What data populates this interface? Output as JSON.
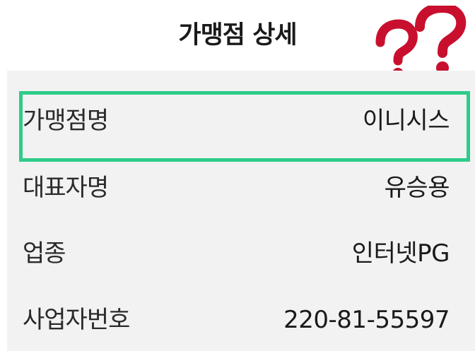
{
  "header": {
    "title": "가맹점 상세"
  },
  "annotation": {
    "icon": "question-marks-icon",
    "question_mark_color": "#c8102e",
    "highlight_color": "#2ecc8a"
  },
  "details": [
    {
      "label": "가맹점명",
      "value": "이니시스"
    },
    {
      "label": "대표자명",
      "value": "유승용"
    },
    {
      "label": "업종",
      "value": "인터넷PG"
    },
    {
      "label": "사업자번호",
      "value": "220-81-55597"
    }
  ]
}
